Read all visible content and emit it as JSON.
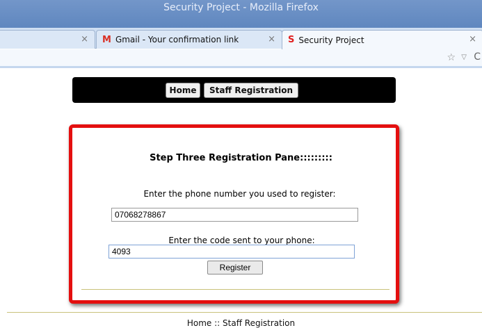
{
  "window": {
    "title": "Security Project - Mozilla Firefox"
  },
  "tabs": [
    {
      "label": "",
      "close": "×"
    },
    {
      "label": "Gmail - Your confirmation link",
      "icon": "gmail-icon",
      "icon_glyph": "M",
      "close": "×"
    },
    {
      "label": "Security Project",
      "icon": "s-favicon-icon",
      "icon_glyph": "S",
      "close": "×",
      "active": true
    }
  ],
  "navbar": {
    "star": "☆",
    "drop": "▽",
    "reload": "C"
  },
  "menu": {
    "home": "Home",
    "staff": "Staff Registration"
  },
  "panel": {
    "title": "Step Three Registration Pane:::::::::",
    "phone_label": "Enter the phone number you used to register:",
    "phone_value": "07068278867",
    "code_label": "Enter the code sent to your phone:",
    "code_value": "4093",
    "register_label": "Register"
  },
  "footer": {
    "text": "Home :: Staff Registration"
  },
  "colors": {
    "panel_border": "#e40f0f",
    "titlebar": "#6b8fc5",
    "menu_bar": "#000000",
    "rule": "#c9c27a"
  }
}
